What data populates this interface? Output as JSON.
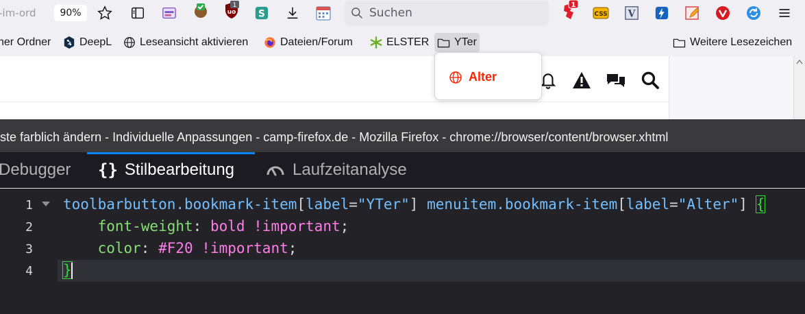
{
  "nav": {
    "url_fragment": "-im-ord",
    "zoom": "90%",
    "search_placeholder": "Suchen",
    "badges": {
      "ublock": "1",
      "ext_red": "1"
    }
  },
  "bookmarks": [
    {
      "label": "ner Ordner",
      "icon": "folder-icon"
    },
    {
      "label": "DeepL",
      "icon": "deepl-icon"
    },
    {
      "label": "Leseansicht aktivieren",
      "icon": "globe-icon"
    },
    {
      "label": "Dateien/Forum",
      "icon": "firefox-icon"
    },
    {
      "label": "ELSTER",
      "icon": "elster-icon"
    },
    {
      "label": "YTer",
      "icon": "folder-icon"
    },
    {
      "label": "Weitere Lesezeichen",
      "icon": "folder-icon"
    }
  ],
  "popup": {
    "item_label": "Alter",
    "color": "#FF2200"
  },
  "devtools": {
    "title": "iste farblich ändern - Individuelle Anpassungen - camp-firefox.de - Mozilla Firefox - chrome://browser/content/browser.xhtml",
    "tabs": [
      {
        "label": "Debugger",
        "icon": ""
      },
      {
        "label": "Stilbearbeitung",
        "icon": "braces-icon",
        "selected": true
      },
      {
        "label": "Laufzeitanalyse",
        "icon": "gauge-icon"
      }
    ]
  },
  "editor": {
    "line_numbers": [
      "1",
      "2",
      "3",
      "4"
    ],
    "line1": {
      "sel1": "toolbarbutton.bookmark-item",
      "attr1": "label",
      "val1": "\"YTer\"",
      "sel2": "menuitem.bookmark-item",
      "attr2": "label",
      "val2": "\"Alter\"",
      "brace": "{"
    },
    "line2": {
      "prop": "font-weight",
      "value": "bold !important"
    },
    "line3": {
      "prop": "color",
      "value": "#F20 !important"
    },
    "line4": {
      "brace": "}"
    }
  },
  "colors": {
    "accent": "#0A84FF",
    "brand_red": "#FF2200"
  }
}
